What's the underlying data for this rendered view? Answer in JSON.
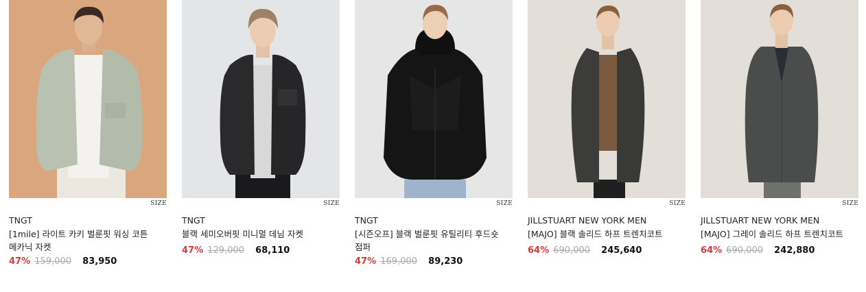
{
  "products": [
    {
      "size_label": "SIZE",
      "brand": "TNGT",
      "name": "[1mile] 라이트 카키 벌룬핏 워싱 코튼 메카닉 자켓",
      "discount": "47%",
      "original_price": "159,000",
      "sale_price": "83,950",
      "bg_color": "#d8a47c",
      "jacket_color": "#b9c2b0"
    },
    {
      "size_label": "SIZE",
      "brand": "TNGT",
      "name": "블랙 세미오버핏 미니멀 데님 자켓",
      "discount": "47%",
      "original_price": "129,000",
      "sale_price": "68,110",
      "bg_color": "#e4e5e7",
      "jacket_color": "#2a2a2c"
    },
    {
      "size_label": "SIZE",
      "brand": "TNGT",
      "name": "[시즌오프] 블랙 벌룬핏 유틸리티 후드숏 점퍼",
      "discount": "47%",
      "original_price": "169,000",
      "sale_price": "89,230",
      "bg_color": "#e6e6e6",
      "jacket_color": "#151515"
    },
    {
      "size_label": "SIZE",
      "brand": "JILLSTUART NEW YORK MEN",
      "name": "[MAJO] 블랙 솔리드 하프 트렌치코트",
      "discount": "64%",
      "original_price": "690,000",
      "sale_price": "245,640",
      "bg_color": "#e3dfd8",
      "jacket_color": "#3c3d3a"
    },
    {
      "size_label": "SIZE",
      "brand": "JILLSTUART NEW YORK MEN",
      "name": "[MAJO] 그레이 솔리드 하프 트렌치코트",
      "discount": "64%",
      "original_price": "690,000",
      "sale_price": "242,880",
      "bg_color": "#e3dfd8",
      "jacket_color": "#4b4d4c"
    }
  ]
}
